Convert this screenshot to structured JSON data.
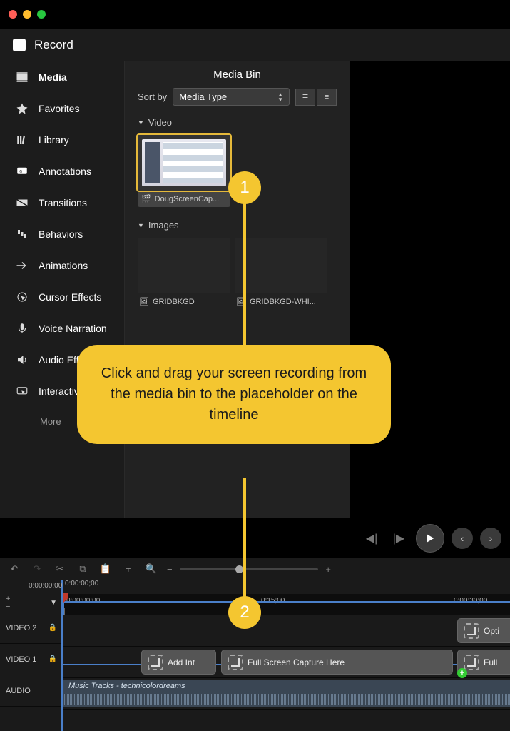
{
  "record_label": "Record",
  "sidebar": [
    {
      "label": "Media",
      "icon": "media"
    },
    {
      "label": "Favorites",
      "icon": "star"
    },
    {
      "label": "Library",
      "icon": "library"
    },
    {
      "label": "Annotations",
      "icon": "annotations"
    },
    {
      "label": "Transitions",
      "icon": "transitions"
    },
    {
      "label": "Behaviors",
      "icon": "behaviors"
    },
    {
      "label": "Animations",
      "icon": "animations"
    },
    {
      "label": "Cursor Effects",
      "icon": "cursor"
    },
    {
      "label": "Voice Narration",
      "icon": "voice"
    },
    {
      "label": "Audio Effects",
      "icon": "audio"
    },
    {
      "label": "Interactivity",
      "icon": "interact"
    }
  ],
  "sidebar_more": "More",
  "media_bin": {
    "title": "Media Bin",
    "sort_label": "Sort by",
    "sort_value": "Media Type",
    "sections": {
      "video": {
        "label": "Video",
        "items": [
          {
            "name": "DougScreenCap..."
          }
        ]
      },
      "images": {
        "label": "Images",
        "items": [
          {
            "name": "GRIDBKGD"
          },
          {
            "name": "GRIDBKGD-WHI..."
          }
        ]
      }
    }
  },
  "timeline": {
    "time_display": "0:00:00;00",
    "playhead_tc": "0:00:00;00",
    "ruler": [
      "0:00:00;00",
      "0:15;00",
      "0:00:30;00"
    ],
    "tracks": {
      "video2": "VIDEO 2",
      "video1": "VIDEO 1",
      "audio": "AUDIO"
    },
    "clips": {
      "v2_opt": "Opti",
      "v1_intro": "Add Int",
      "v1_full": "Full Screen Capture Here",
      "v1_end": "Full",
      "audio": "Music Tracks - technicolordreams"
    }
  },
  "callout": {
    "text": "Click and drag your screen recording from the media bin to the placeholder on the timeline",
    "n1": "1",
    "n2": "2"
  }
}
